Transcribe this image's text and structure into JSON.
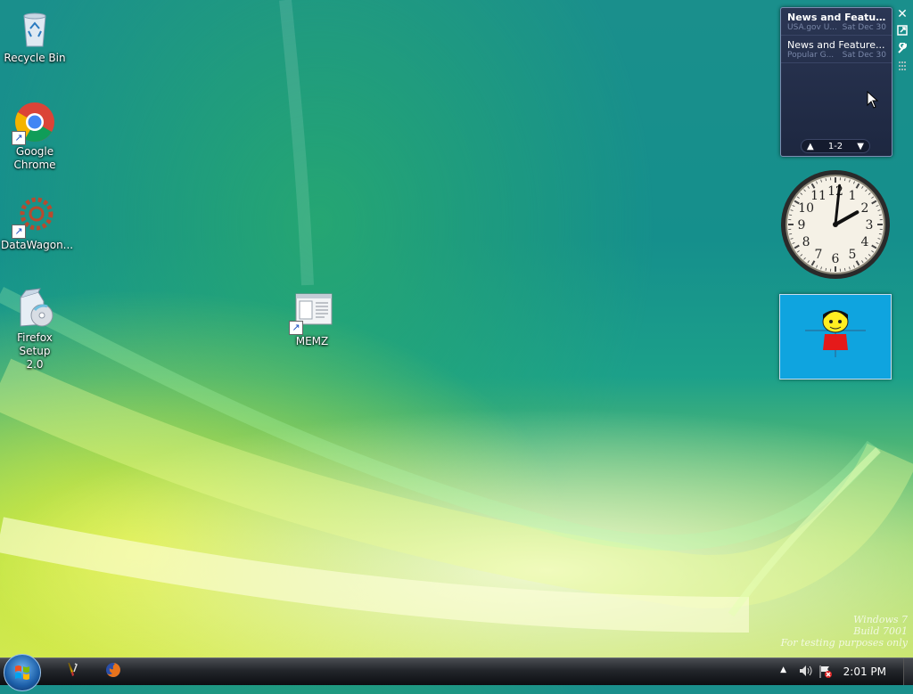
{
  "desktop_icons": [
    {
      "label": "Recycle Bin",
      "icon": "recycle-bin-icon"
    },
    {
      "label": "Google\nChrome",
      "icon": "chrome-icon"
    },
    {
      "label": "DataWagon...",
      "icon": "datawagon-icon"
    },
    {
      "label": "Firefox Setup\n2.0",
      "icon": "installer-icon"
    },
    {
      "label": "MEMZ",
      "icon": "memz-icon"
    }
  ],
  "rss_gadget": {
    "items": [
      {
        "title": "News and Features f...",
        "source": "USA.gov U...",
        "date": "Sat Dec 30"
      },
      {
        "title": "News and Feature...",
        "source": "Popular G...",
        "date": "Sat Dec 30"
      }
    ],
    "pager": "1-2"
  },
  "gadget_controls": [
    "close-icon",
    "popout-icon",
    "options-icon",
    "drag-handle-icon"
  ],
  "clock_gadget": {
    "hour": 2,
    "minute": 1,
    "numerals": [
      "12",
      "1",
      "2",
      "3",
      "4",
      "5",
      "6",
      "7",
      "8",
      "9",
      "10",
      "11"
    ]
  },
  "watermark": {
    "line1": "Windows 7",
    "line2": "Build 7001",
    "line3": "For testing purposes only"
  },
  "taskbar": {
    "pinned": [
      "paint-icon",
      "firefox-icon"
    ],
    "tray_icons": [
      "show-hidden-icons-arrow",
      "volume-icon",
      "action-center-flag-icon"
    ],
    "time": "2:01 PM"
  },
  "colors": {
    "accent": "#1a8f8c",
    "taskbar": "#23262b",
    "gadget_bg": "#1d2740"
  }
}
